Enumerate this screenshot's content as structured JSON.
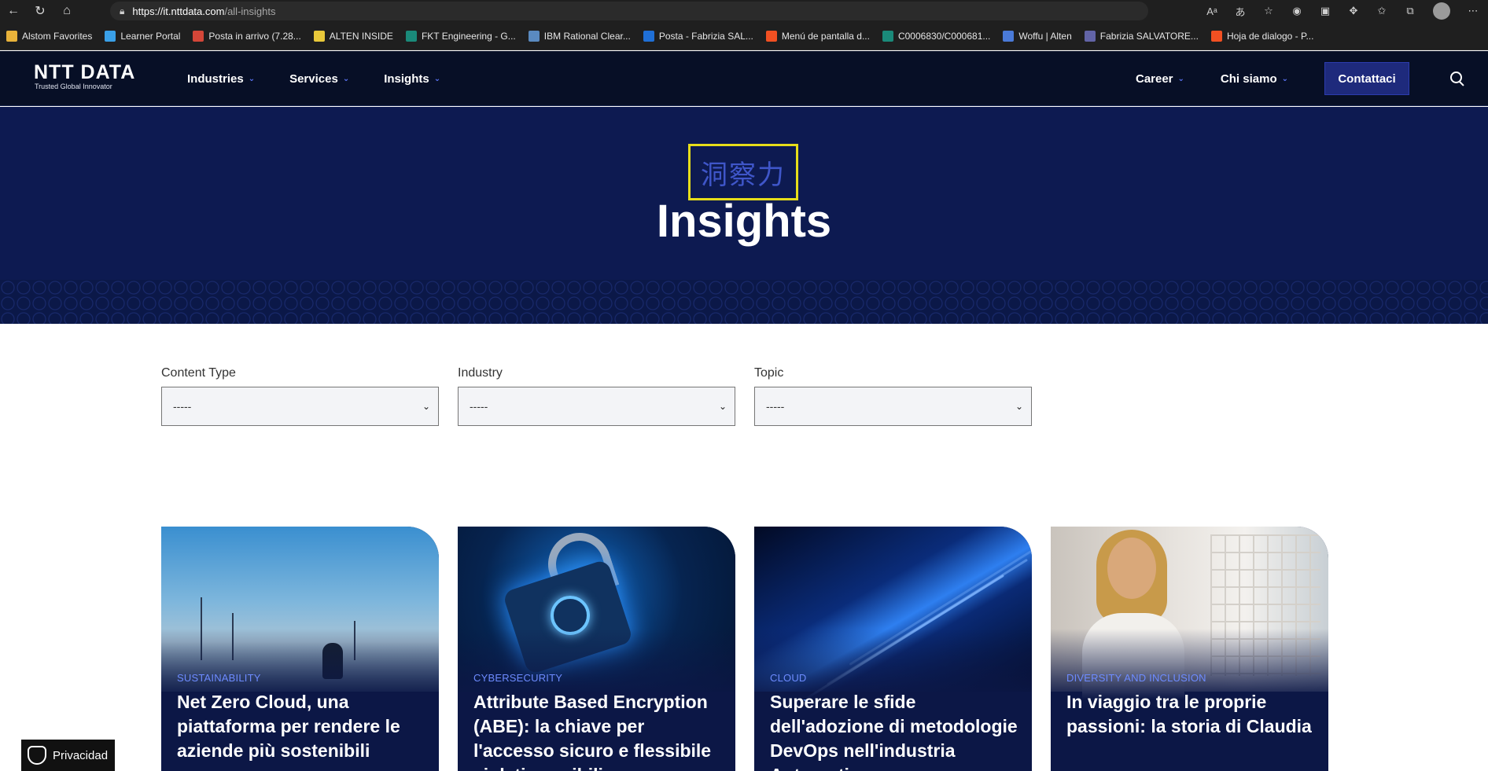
{
  "browser": {
    "url_host": "https://it.nttdata.com",
    "url_path": "/all-insights",
    "bookmarks": [
      {
        "label": "Alstom Favorites",
        "color": "#e8b23a"
      },
      {
        "label": "Learner Portal",
        "color": "#3aa0e8"
      },
      {
        "label": "Posta in arrivo (7.28...",
        "color": "#d44638"
      },
      {
        "label": "ALTEN INSIDE",
        "color": "#e8c83a"
      },
      {
        "label": "FKT Engineering - G...",
        "color": "#1a8a7a"
      },
      {
        "label": "IBM Rational Clear...",
        "color": "#5a8ac0"
      },
      {
        "label": "Posta - Fabrizia SAL...",
        "color": "#1f6fd6"
      },
      {
        "label": "Menú de pantalla d...",
        "color": "#f25022"
      },
      {
        "label": "C0006830/C000681...",
        "color": "#1a8a7a"
      },
      {
        "label": "Woffu | Alten",
        "color": "#4a7ad8"
      },
      {
        "label": "Fabrizia SALVATORE...",
        "color": "#6264a7"
      },
      {
        "label": "Hoja de dialogo - P...",
        "color": "#f25022"
      }
    ]
  },
  "header": {
    "logo_brand": "NTT DATA",
    "logo_tagline": "Trusted Global Innovator",
    "nav": [
      {
        "label": "Industries"
      },
      {
        "label": "Services"
      },
      {
        "label": "Insights"
      }
    ],
    "right_nav": [
      {
        "label": "Career"
      },
      {
        "label": "Chi siamo"
      }
    ],
    "cta": "Contattaci"
  },
  "hero": {
    "kanji": "洞察力",
    "title": "Insights"
  },
  "filters": [
    {
      "label": "Content Type",
      "value": "-----"
    },
    {
      "label": "Industry",
      "value": "-----"
    },
    {
      "label": "Topic",
      "value": "-----"
    }
  ],
  "cards": [
    {
      "category": "SUSTAINABILITY",
      "title": "Net Zero Cloud, una piattaforma per rendere le aziende più sostenibili"
    },
    {
      "category": "CYBERSECURITY",
      "title": "Attribute Based Encryption (ABE): la chiave per l'accesso sicuro e flessibile ai dati sensibili"
    },
    {
      "category": "CLOUD",
      "title": "Superare le sfide dell'adozione di metodologie DevOps nell'industria Automotive"
    },
    {
      "category": "DIVERSITY AND INCLUSION",
      "title": "In viaggio tra le proprie passioni: la storia di Claudia"
    }
  ],
  "privacy": "Privacidad"
}
